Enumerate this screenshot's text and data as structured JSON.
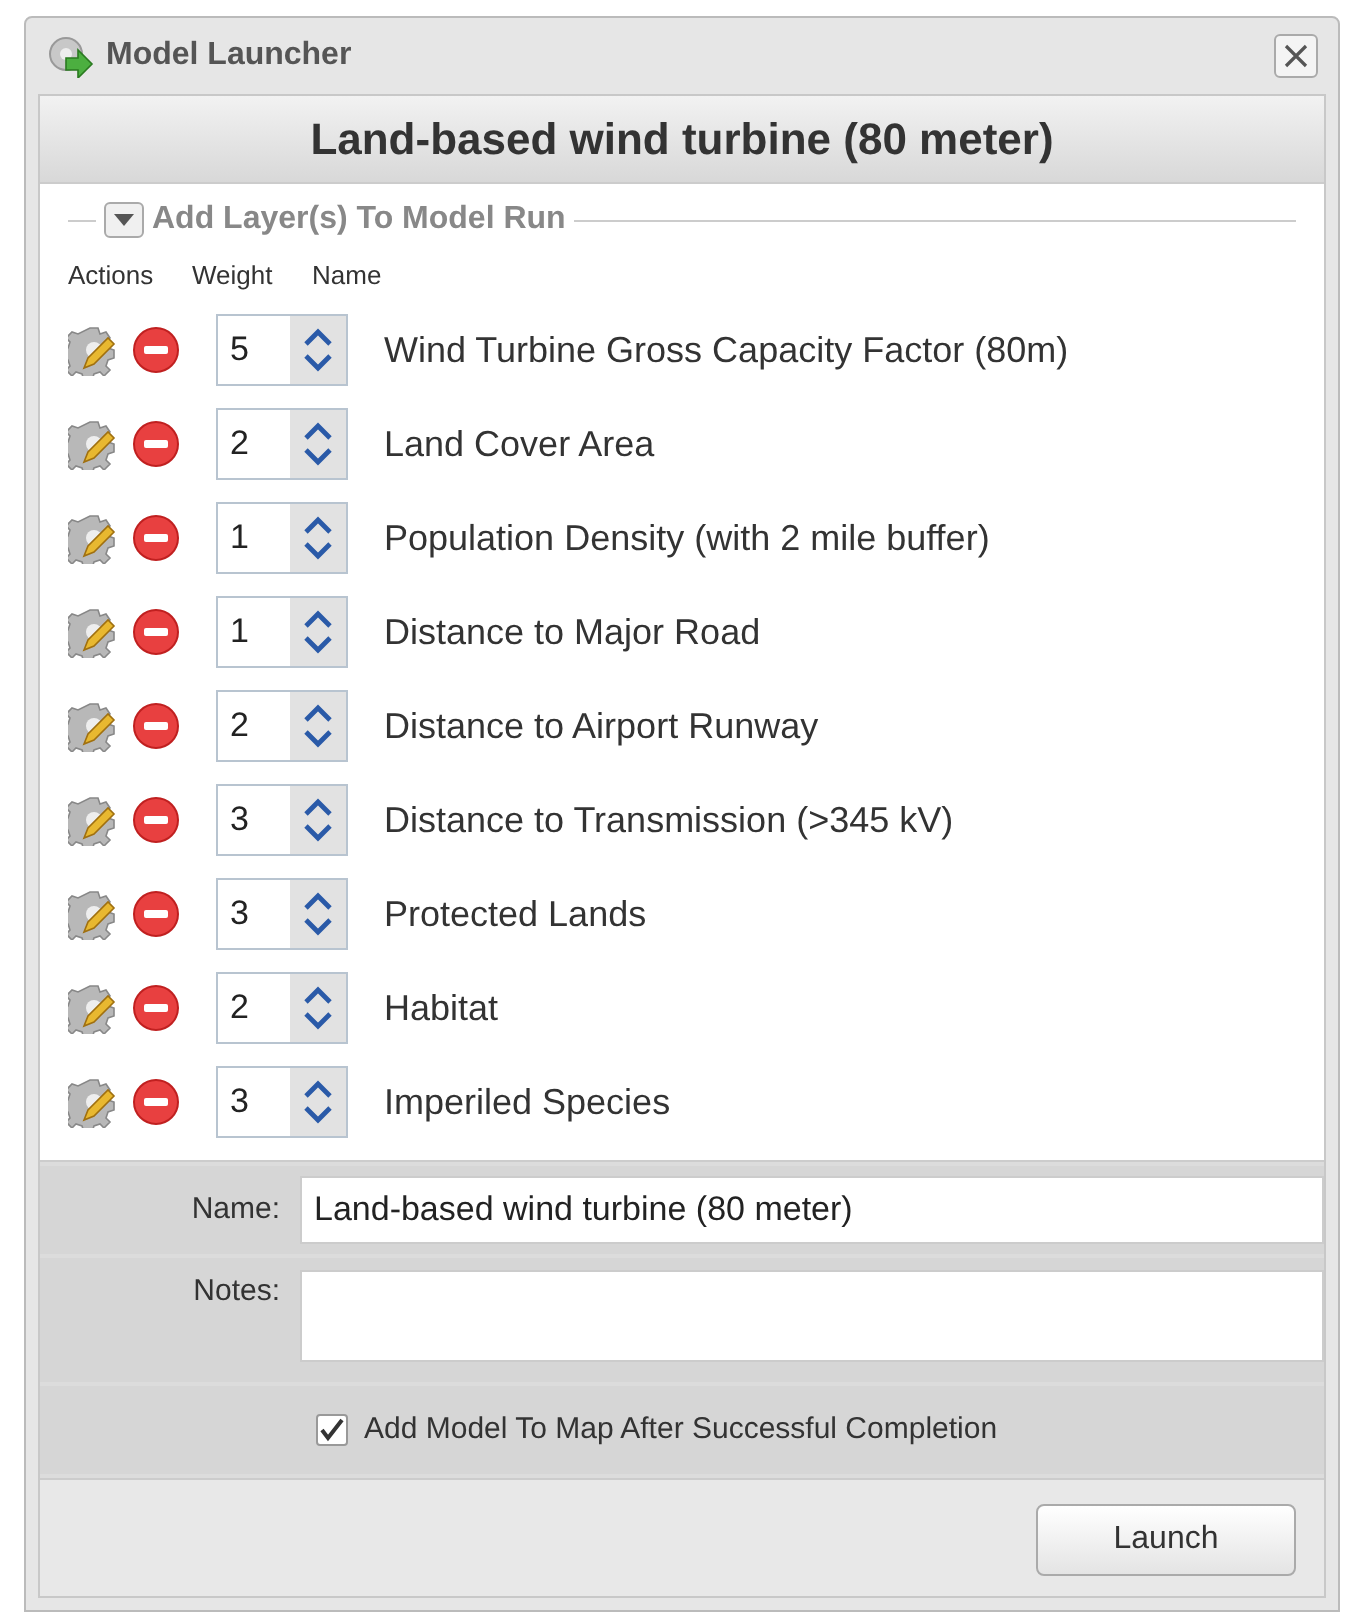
{
  "window": {
    "title": "Model Launcher"
  },
  "header": {
    "title": "Land-based wind turbine (80 meter)"
  },
  "layers_section": {
    "legend": "Add Layer(s) To Model Run",
    "expanded": true,
    "columns": [
      "Actions",
      "Weight",
      "Name"
    ],
    "rows": [
      {
        "weight": "5",
        "name": "Wind Turbine Gross Capacity Factor (80m)"
      },
      {
        "weight": "2",
        "name": "Land Cover Area"
      },
      {
        "weight": "1",
        "name": "Population Density (with 2 mile buffer)"
      },
      {
        "weight": "1",
        "name": "Distance to Major Road"
      },
      {
        "weight": "2",
        "name": "Distance to Airport Runway"
      },
      {
        "weight": "3",
        "name": "Distance to Transmission (>345 kV)"
      },
      {
        "weight": "3",
        "name": "Protected Lands"
      },
      {
        "weight": "2",
        "name": "Habitat"
      },
      {
        "weight": "3",
        "name": "Imperiled Species"
      }
    ]
  },
  "form": {
    "name_label": "Name:",
    "name_value": "Land-based wind turbine (80 meter)",
    "notes_label": "Notes:",
    "add_to_map": {
      "label": "Add Model To Map After Successful Completion",
      "checked": true
    }
  },
  "buttons": [
    "Launch"
  ]
}
